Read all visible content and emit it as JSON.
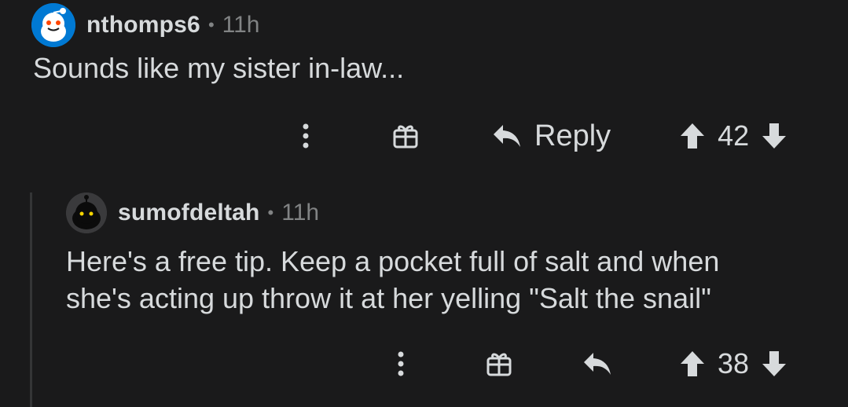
{
  "comments": [
    {
      "username": "nthomps6",
      "separator": "•",
      "age": "11h",
      "body": "Sounds like my sister in-law...",
      "reply_label": "Reply",
      "score": "42",
      "avatar_icon": "snoo-avatar-icon",
      "accent_color": "#0079d3"
    },
    {
      "username": "sumofdeltah",
      "separator": "•",
      "age": "11h",
      "body_line1": "Here's a free tip. Keep a pocket full of salt and when",
      "body_line2": "she's acting up throw it at her yelling \"Salt the snail\"",
      "score": "38",
      "avatar_icon": "dark-snoo-avatar-icon"
    }
  ],
  "icons": {
    "more": "vertical-dots-icon",
    "award": "gift-icon",
    "reply": "reply-arrow-icon",
    "upvote": "upvote-arrow-icon",
    "downvote": "downvote-arrow-icon"
  }
}
